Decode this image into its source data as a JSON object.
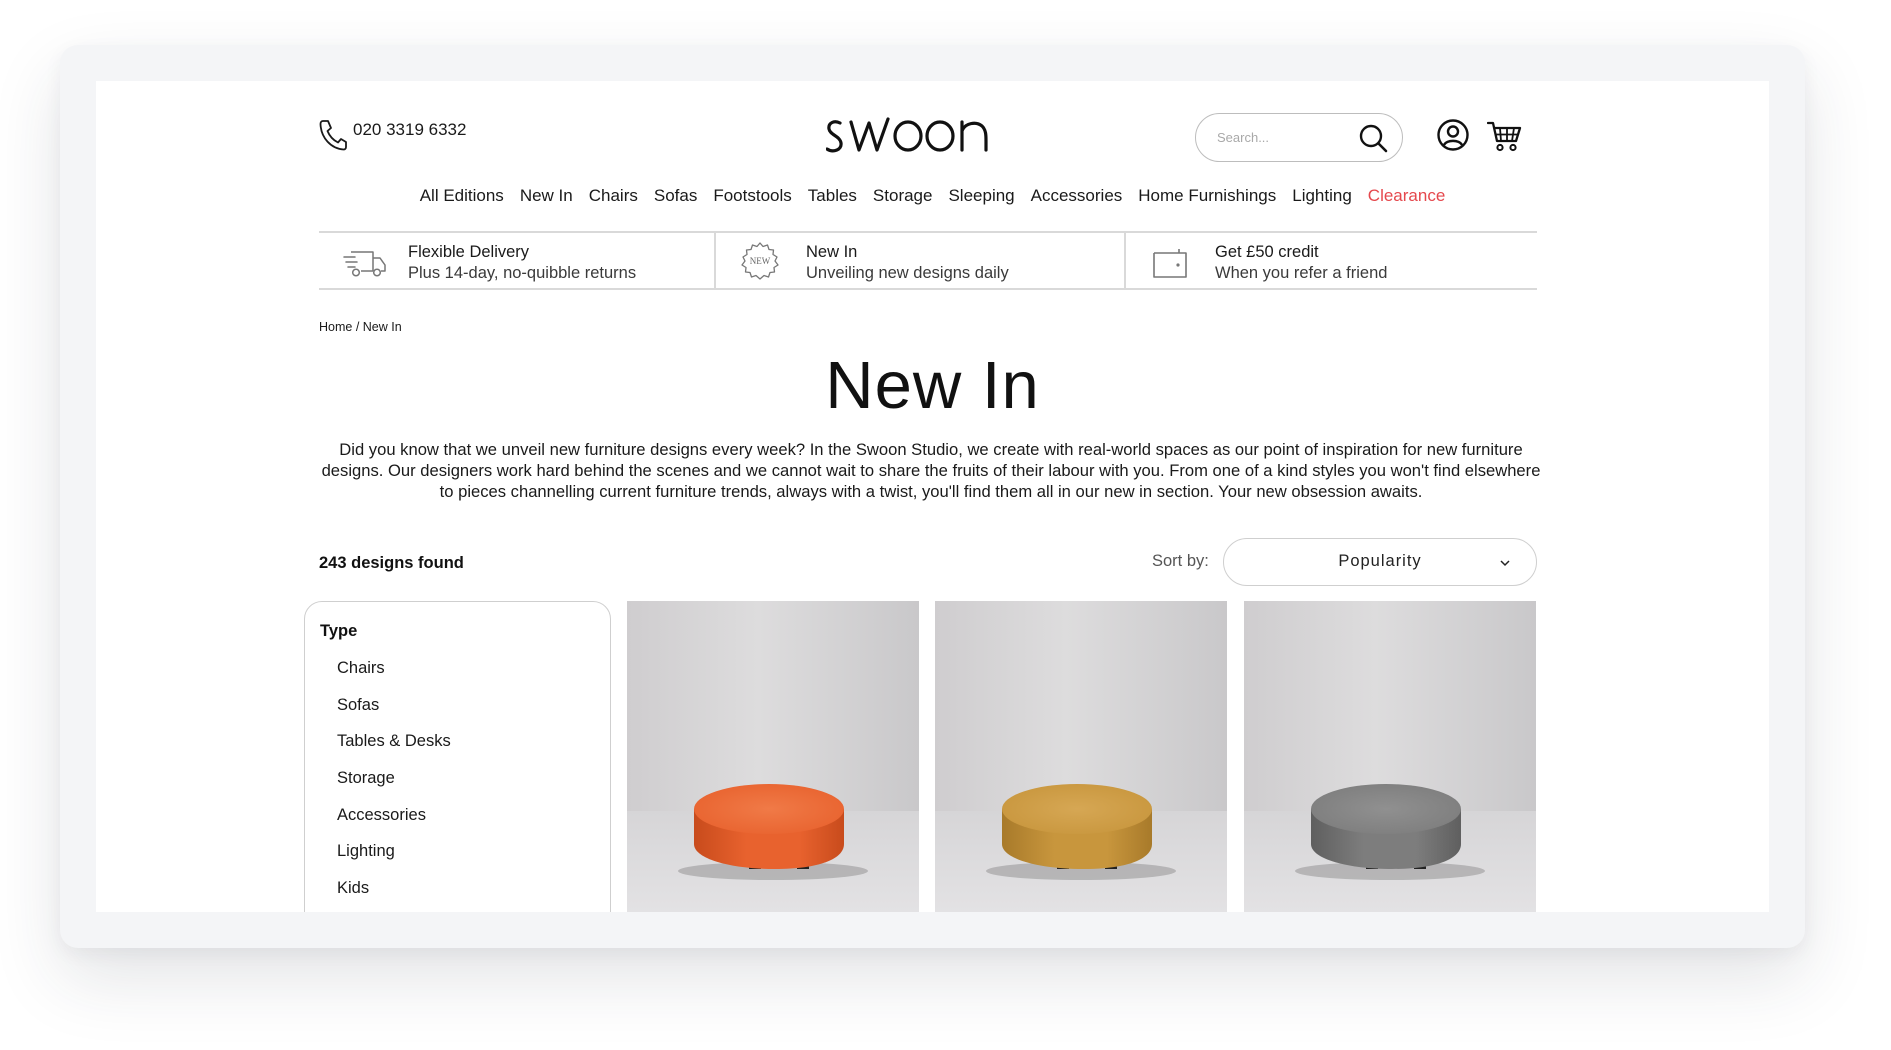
{
  "header": {
    "phone": "020 3319 6332",
    "logo_text": "swoon",
    "search_placeholder": "Search..."
  },
  "nav": {
    "items": [
      "All Editions",
      "New In",
      "Chairs",
      "Sofas",
      "Footstools",
      "Tables",
      "Storage",
      "Sleeping",
      "Accessories",
      "Home Furnishings",
      "Lighting"
    ],
    "clearance": "Clearance"
  },
  "usp": [
    {
      "title": "Flexible Delivery",
      "subtitle": "Plus 14-day, no-quibble returns",
      "icon": "delivery-truck-icon"
    },
    {
      "title": "New In",
      "subtitle": "Unveiling new designs daily",
      "icon": "new-badge-icon",
      "badge_text": "NEW"
    },
    {
      "title": "Get £50 credit",
      "subtitle": "When you refer a friend",
      "icon": "wallet-icon"
    }
  ],
  "breadcrumb": {
    "home": "Home",
    "separator": " / ",
    "current": "New In"
  },
  "page": {
    "title": "New In",
    "intro": "Did you know that we unveil new furniture designs every week? In the Swoon Studio, we create with real-world spaces as our point of inspiration for new furniture designs. Our designers work hard behind the scenes and we cannot wait to share the fruits of their labour with you. From one of a kind styles you won't find elsewhere to pieces channelling current furniture trends, always with a twist, you'll find them all in our new in section. Your new obsession awaits."
  },
  "results": {
    "count_text": "243 designs found",
    "sort_label": "Sort by:",
    "sort_value": "Popularity"
  },
  "filter": {
    "heading": "Type",
    "items": [
      "Chairs",
      "Sofas",
      "Tables & Desks",
      "Storage",
      "Accessories",
      "Lighting",
      "Kids"
    ]
  },
  "products": [
    {
      "colour": "#e8622e",
      "shade": "#c84b1c",
      "top": "#f07a47"
    },
    {
      "colour": "#c8963d",
      "shade": "#a87a2a",
      "top": "#d6a754"
    },
    {
      "colour": "#7d7d7d",
      "shade": "#5f5f5f",
      "top": "#909090"
    }
  ],
  "colors": {
    "accent_red": "#e5484d",
    "border": "#d9d9d9"
  }
}
